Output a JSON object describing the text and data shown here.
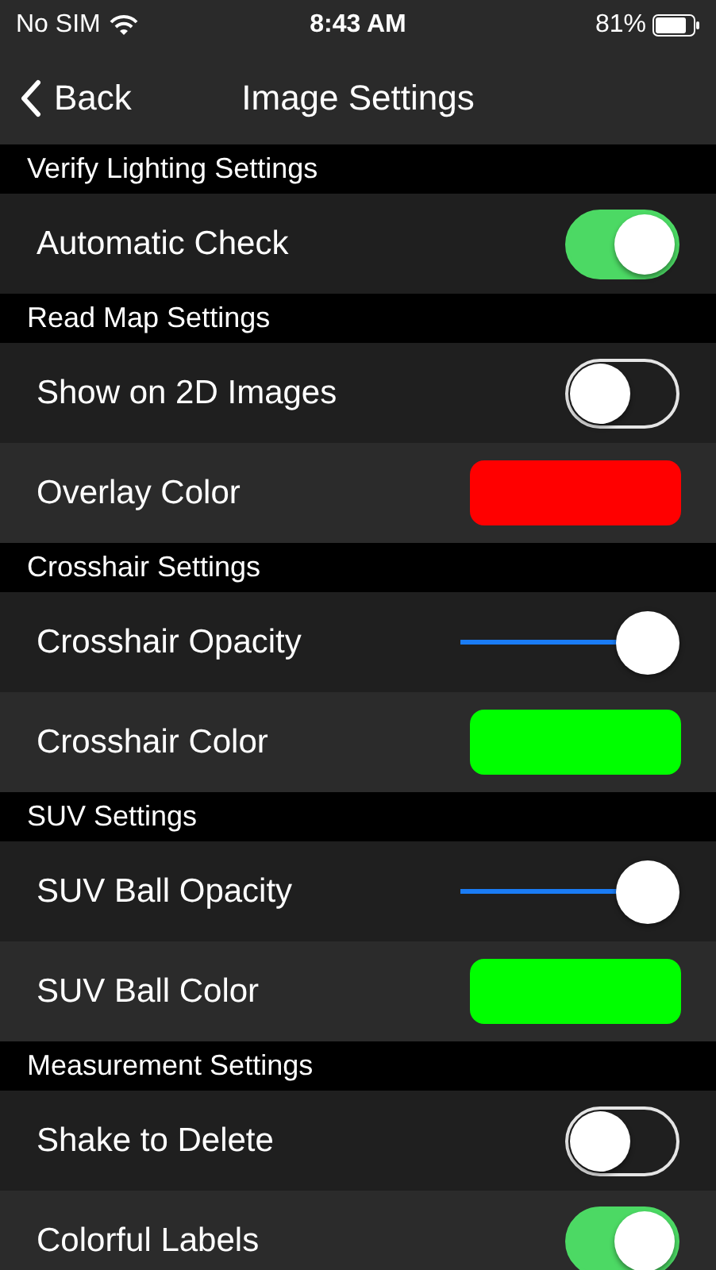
{
  "status_bar": {
    "carrier": "No SIM",
    "time": "8:43 AM",
    "battery": "81%"
  },
  "nav_bar": {
    "back": "Back",
    "title": "Image Settings"
  },
  "sections": [
    {
      "title": "Verify Lighting Settings",
      "rows": [
        {
          "kind": "toggle",
          "label": "Automatic Check",
          "on": true
        }
      ]
    },
    {
      "title": "Read Map Settings",
      "rows": [
        {
          "kind": "toggle",
          "label": "Show on 2D Images",
          "on": false
        },
        {
          "kind": "color",
          "label": "Overlay Color",
          "color": "#ff0000"
        }
      ]
    },
    {
      "title": "Crosshair Settings",
      "rows": [
        {
          "kind": "slider",
          "label": "Crosshair Opacity",
          "level": 1
        },
        {
          "kind": "color",
          "label": "Crosshair Color",
          "color": "#00ff00"
        }
      ]
    },
    {
      "title": "SUV Settings",
      "rows": [
        {
          "kind": "slider",
          "label": "SUV Ball Opacity",
          "level": 1
        },
        {
          "kind": "color",
          "label": "SUV Ball Color",
          "color": "#00ff00"
        }
      ]
    },
    {
      "title": "Measurement Settings",
      "rows": [
        {
          "kind": "toggle",
          "label": "Shake to Delete",
          "on": false
        },
        {
          "kind": "toggle",
          "label": "Colorful Labels",
          "on": true
        }
      ]
    }
  ]
}
